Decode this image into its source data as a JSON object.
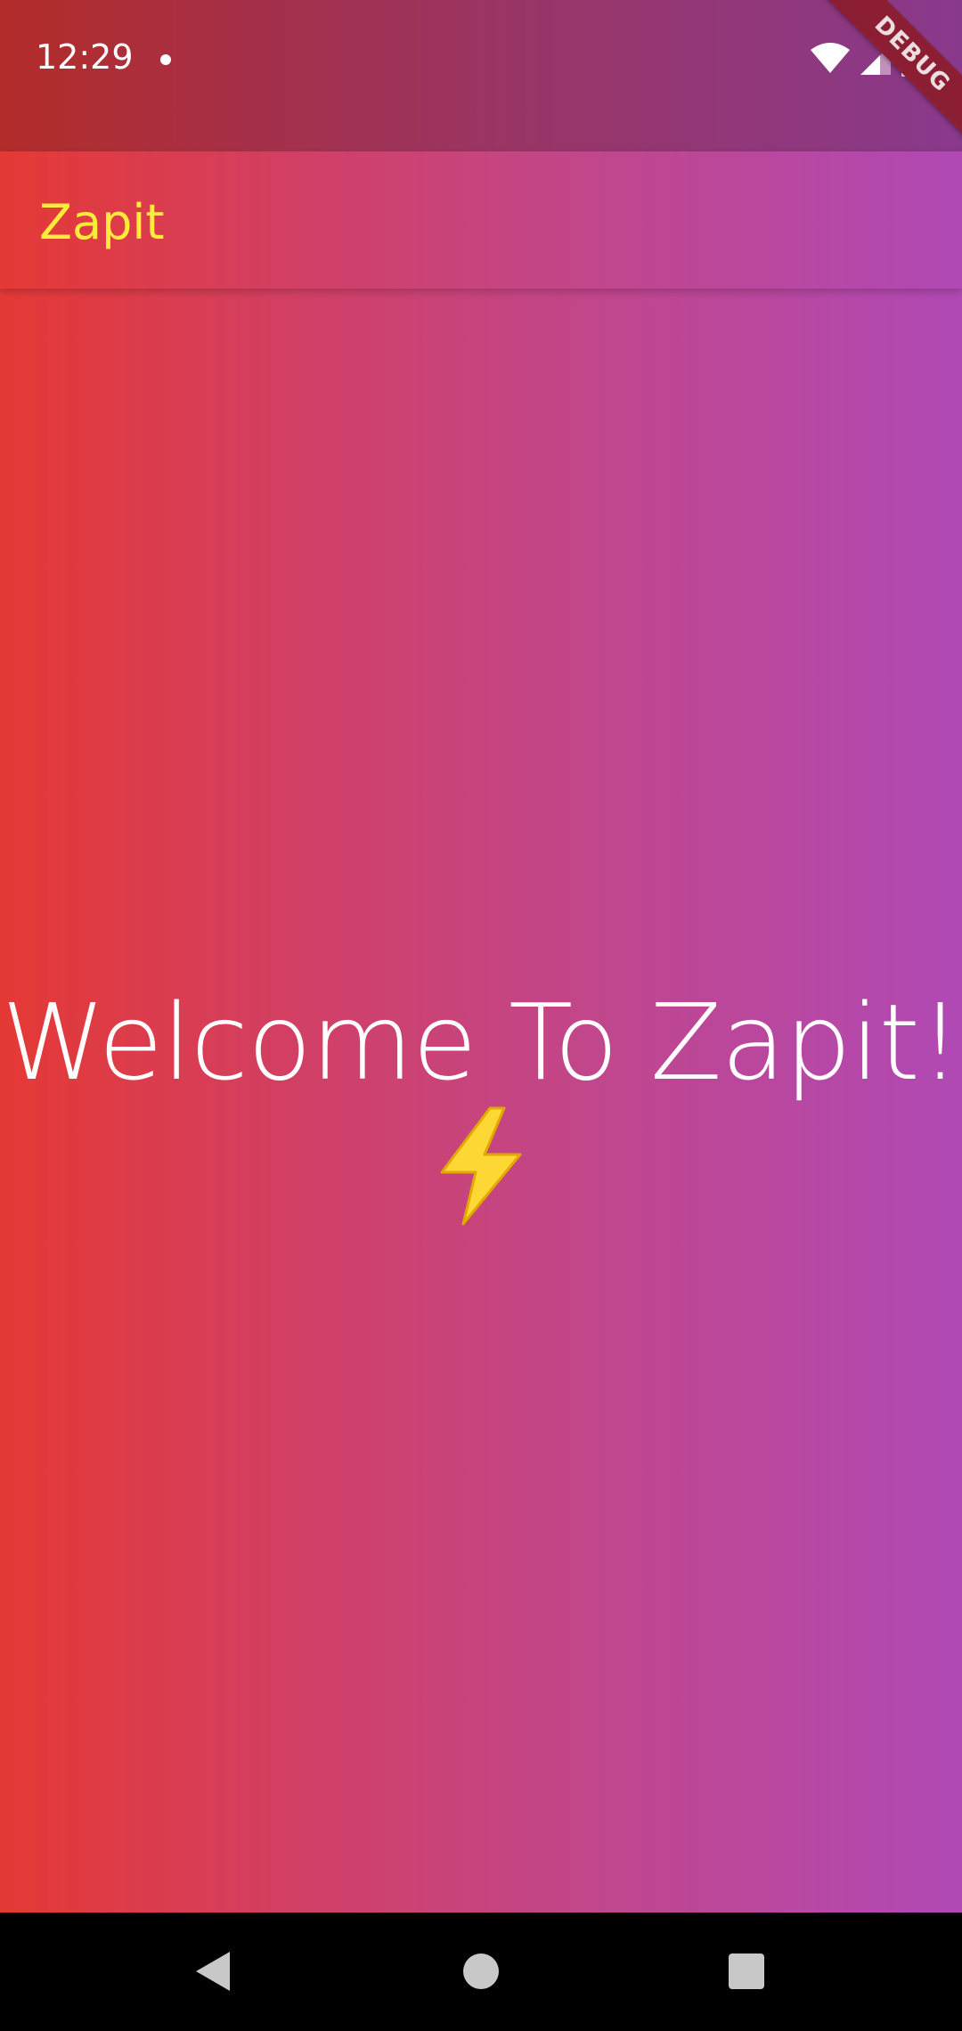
{
  "status_bar": {
    "time": "12:29",
    "icons": [
      "wifi-icon",
      "cell-signal-icon",
      "battery-icon"
    ]
  },
  "debug_banner": {
    "label": "DEBUG"
  },
  "app_bar": {
    "title": "Zapit",
    "title_color": "#ffeb3b"
  },
  "main": {
    "welcome_text": "Welcome To Zapit!",
    "emoji": "high-voltage-icon"
  },
  "nav_bar": {
    "buttons": [
      "back-icon",
      "home-icon",
      "recents-icon"
    ]
  },
  "colors": {
    "gradient_start": "#e53935",
    "gradient_end": "#b049b4",
    "bolt": "#fdd835"
  }
}
